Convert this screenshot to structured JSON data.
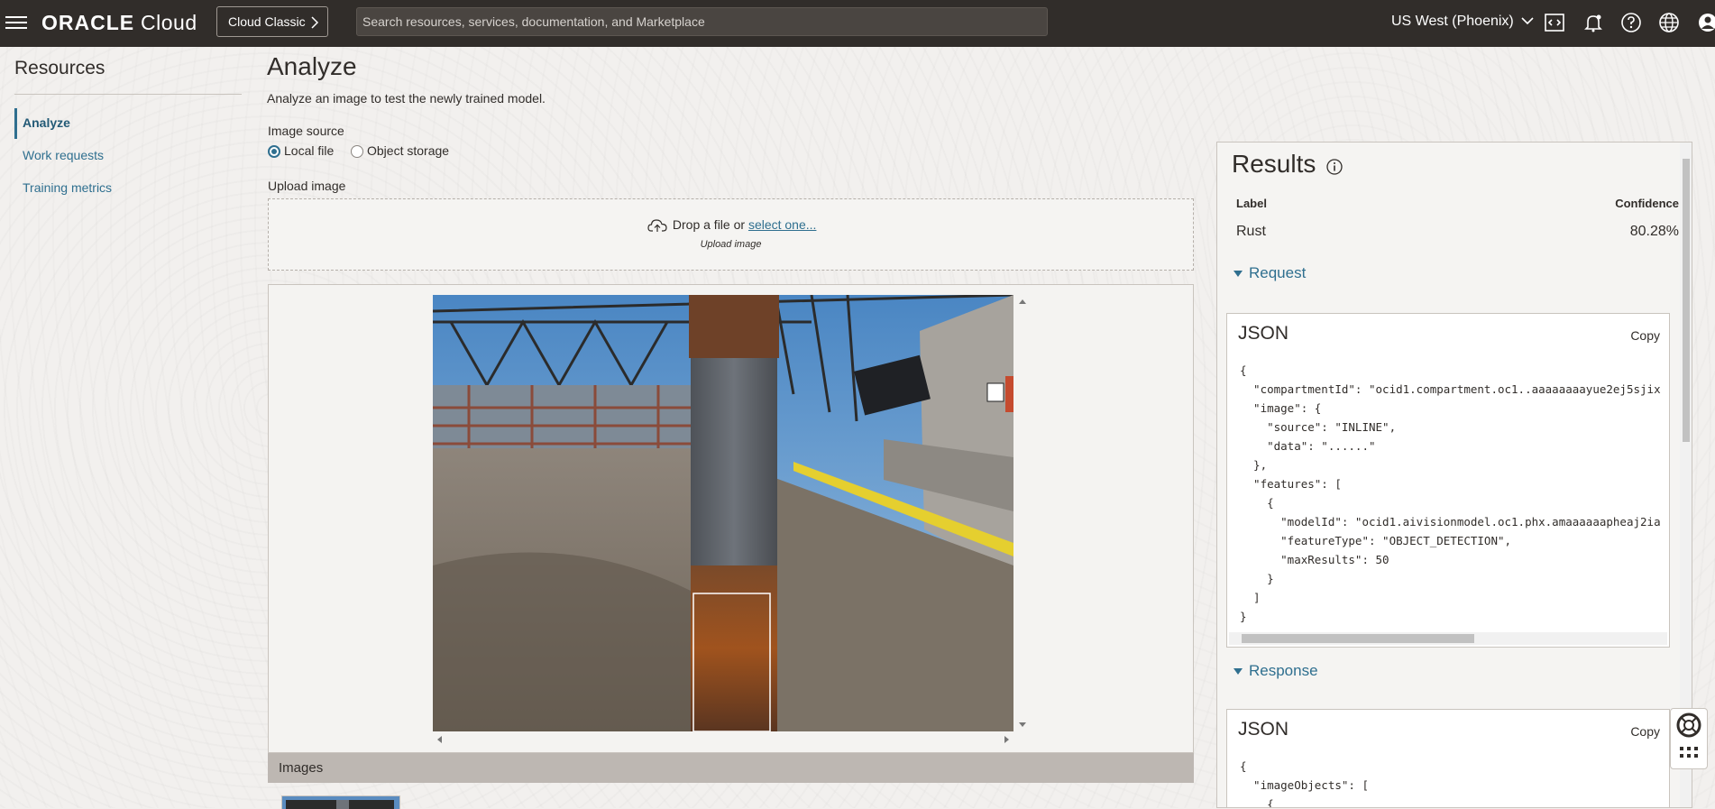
{
  "header": {
    "brand": "ORACLE",
    "brand_suffix": "Cloud",
    "classic_button": "Cloud Classic",
    "search_placeholder": "Search resources, services, documentation, and Marketplace",
    "region": "US West (Phoenix)",
    "icons": [
      "hamburger-menu-icon",
      "code-editor-icon",
      "bell-icon",
      "help-icon",
      "globe-icon",
      "user-icon"
    ]
  },
  "sidebar": {
    "title": "Resources",
    "items": [
      {
        "label": "Analyze",
        "active": true
      },
      {
        "label": "Work requests",
        "active": false
      },
      {
        "label": "Training metrics",
        "active": false
      }
    ]
  },
  "main": {
    "title": "Analyze",
    "subtitle": "Analyze an image to test the newly trained model.",
    "image_source_label": "Image source",
    "image_source_options": [
      {
        "label": "Local file",
        "selected": true
      },
      {
        "label": "Object storage",
        "selected": false
      }
    ],
    "upload_label": "Upload image",
    "drop_text": "Drop a file or",
    "drop_link": "select one...",
    "drop_hint": "Upload image",
    "images_section": "Images"
  },
  "results": {
    "title": "Results",
    "columns": {
      "label": "Label",
      "confidence": "Confidence"
    },
    "rows": [
      {
        "label": "Rust",
        "confidence": "80.28%"
      }
    ],
    "request": {
      "toggle": "Request",
      "card_title": "JSON",
      "copy": "Copy",
      "code": "{\n  \"compartmentId\": \"ocid1.compartment.oc1..aaaaaaaayue2ej5sjix\n  \"image\": {\n    \"source\": \"INLINE\",\n    \"data\": \"......\"\n  },\n  \"features\": [\n    {\n      \"modelId\": \"ocid1.aivisionmodel.oc1.phx.amaaaaaapheaj2ia\n      \"featureType\": \"OBJECT_DETECTION\",\n      \"maxResults\": 50\n    }\n  ]\n}"
    },
    "response": {
      "toggle": "Response",
      "card_title": "JSON",
      "copy": "Copy",
      "code": "{\n  \"imageObjects\": [\n    {"
    }
  },
  "colors": {
    "header_bg": "#312d2a",
    "link": "#2f6f8f",
    "page_bg": "#f2f0ee"
  }
}
